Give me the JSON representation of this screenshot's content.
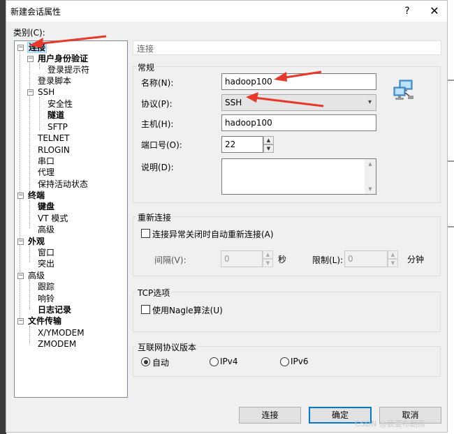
{
  "window": {
    "title": "新建会话属性",
    "help_label": "?",
    "close_label": "✕"
  },
  "category": {
    "label": "类别(C):",
    "items": [
      {
        "label": "连接"
      },
      {
        "label": "用户身份验证"
      },
      {
        "label": "登录提示符"
      },
      {
        "label": "登录脚本"
      },
      {
        "label": "SSH"
      },
      {
        "label": "安全性"
      },
      {
        "label": "隧道"
      },
      {
        "label": "SFTP"
      },
      {
        "label": "TELNET"
      },
      {
        "label": "RLOGIN"
      },
      {
        "label": "串口"
      },
      {
        "label": "代理"
      },
      {
        "label": "保持活动状态"
      },
      {
        "label": "终端"
      },
      {
        "label": "键盘"
      },
      {
        "label": "VT 模式"
      },
      {
        "label": "高级"
      },
      {
        "label": "外观"
      },
      {
        "label": "窗口"
      },
      {
        "label": "突出"
      },
      {
        "label": "高级"
      },
      {
        "label": "跟踪"
      },
      {
        "label": "响铃"
      },
      {
        "label": "日志记录"
      },
      {
        "label": "文件传输"
      },
      {
        "label": "X/YMODEM"
      },
      {
        "label": "ZMODEM"
      }
    ]
  },
  "header": {
    "title": "连接"
  },
  "general": {
    "group_label": "常规",
    "name_label": "名称(N):",
    "name_value": "hadoop100",
    "protocol_label": "协议(P):",
    "protocol_value": "SSH",
    "host_label": "主机(H):",
    "host_value": "hadoop100",
    "port_label": "端口号(O):",
    "port_value": "22",
    "desc_label": "说明(D):"
  },
  "reconnect": {
    "group_label": "重新连接",
    "checkbox_label": "连接异常关闭时自动重新连接(A)",
    "interval_label": "间隔(V):",
    "interval_value": "0",
    "interval_unit": "秒",
    "limit_label": "限制(L):",
    "limit_value": "0",
    "limit_unit": "分钟"
  },
  "tcp": {
    "group_label": "TCP选项",
    "nagle_label": "使用Nagle算法(U)"
  },
  "ip_version": {
    "group_label": "互联网协议版本",
    "options": [
      "自动",
      "IPv4",
      "IPv6"
    ],
    "selected": "自动"
  },
  "buttons": {
    "connect": "连接",
    "ok": "确定",
    "cancel": "取消"
  },
  "watermark": "CSDN @我要布朗熊",
  "colors": {
    "selection": "#cce8ff",
    "default_button_border": "#0078d7",
    "annotation_arrow": "#e8382c"
  },
  "icons": {
    "spin_up": "▲",
    "spin_down": "▼",
    "dropdown": "▾",
    "expanded": "−"
  }
}
